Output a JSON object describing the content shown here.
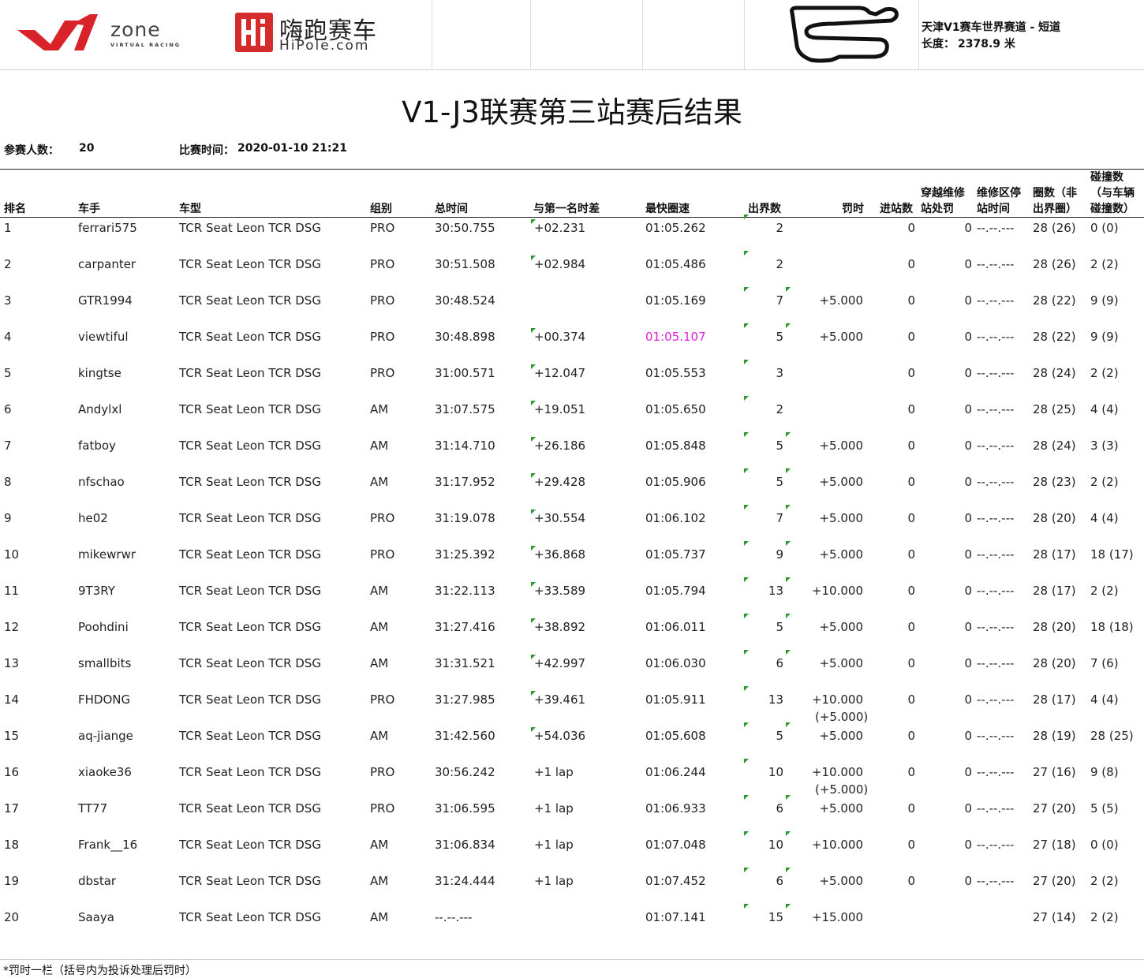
{
  "header": {
    "v1_logo": {
      "word": "zone",
      "tagline": "VIRTUAL RACING"
    },
    "hipole_logo": {
      "badge_text": "Hi",
      "name_cn": "嗨跑赛车",
      "domain": "HiPole.com"
    },
    "track": {
      "name": "天津V1赛车世界赛道 - 短道",
      "length_label": "长度：",
      "length_value": "2378.9 米"
    }
  },
  "title": "V1-J3联赛第三站赛后结果",
  "meta": {
    "entrants_label": "参赛人数：",
    "entrants_value": "20",
    "race_time_label": "比赛时间：",
    "race_time_value": "2020-01-10 21:21"
  },
  "columns": {
    "rank": "排名",
    "driver": "车手",
    "car": "车型",
    "group": "组别",
    "total_time": "总时间",
    "gap": "与第一名时差",
    "best_lap": "最快圈速",
    "cuts": "出界数",
    "penalty": "罚时",
    "pit_stops": "进站数",
    "drive_through_1": "穿越维修",
    "drive_through_2": "站处罚",
    "pit_time_1": "维修区停",
    "pit_time_2": "站时间",
    "laps_1": "圈数（非",
    "laps_2": "出界圈）",
    "collisions_1": "碰撞数",
    "collisions_2": "（与车辆",
    "collisions_3": "碰撞数）"
  },
  "rows": [
    {
      "rank": "1",
      "driver": "ferrari575",
      "car": "TCR Seat Leon TCR DSG",
      "group": "PRO",
      "total": "30:50.755",
      "gap": "+02.231",
      "best": "01:05.262",
      "cuts": "2",
      "penalty": "",
      "penalty_note": "",
      "pit": "0",
      "dt": "0",
      "pit_time": "--.--.---",
      "laps": "28 (26)",
      "coll": "0 (0)",
      "best_purple": false,
      "gap_flag": true,
      "cuts_flag_left": true,
      "cuts_flag_right": false
    },
    {
      "rank": "2",
      "driver": "carpanter",
      "car": "TCR Seat Leon TCR DSG",
      "group": "PRO",
      "total": "30:51.508",
      "gap": "+02.984",
      "best": "01:05.486",
      "cuts": "2",
      "penalty": "",
      "penalty_note": "",
      "pit": "0",
      "dt": "0",
      "pit_time": "--.--.---",
      "laps": "28 (26)",
      "coll": "2 (2)",
      "best_purple": false,
      "gap_flag": true,
      "cuts_flag_left": true,
      "cuts_flag_right": false
    },
    {
      "rank": "3",
      "driver": "GTR1994",
      "car": "TCR Seat Leon TCR DSG",
      "group": "PRO",
      "total": "30:48.524",
      "gap": "",
      "best": "01:05.169",
      "cuts": "7",
      "penalty": "+5.000",
      "penalty_note": "",
      "pit": "0",
      "dt": "0",
      "pit_time": "--.--.---",
      "laps": "28 (22)",
      "coll": "9 (9)",
      "best_purple": false,
      "gap_flag": false,
      "cuts_flag_left": true,
      "cuts_flag_right": true
    },
    {
      "rank": "4",
      "driver": "viewtiful",
      "car": "TCR Seat Leon TCR DSG",
      "group": "PRO",
      "total": "30:48.898",
      "gap": "+00.374",
      "best": "01:05.107",
      "cuts": "5",
      "penalty": "+5.000",
      "penalty_note": "",
      "pit": "0",
      "dt": "0",
      "pit_time": "--.--.---",
      "laps": "28 (22)",
      "coll": "9 (9)",
      "best_purple": true,
      "gap_flag": true,
      "cuts_flag_left": true,
      "cuts_flag_right": true
    },
    {
      "rank": "5",
      "driver": "kingtse",
      "car": "TCR Seat Leon TCR DSG",
      "group": "PRO",
      "total": "31:00.571",
      "gap": "+12.047",
      "best": "01:05.553",
      "cuts": "3",
      "penalty": "",
      "penalty_note": "",
      "pit": "0",
      "dt": "0",
      "pit_time": "--.--.---",
      "laps": "28 (24)",
      "coll": "2 (2)",
      "best_purple": false,
      "gap_flag": true,
      "cuts_flag_left": true,
      "cuts_flag_right": false
    },
    {
      "rank": "6",
      "driver": "Andylxl",
      "car": "TCR Seat Leon TCR DSG",
      "group": "AM",
      "total": "31:07.575",
      "gap": "+19.051",
      "best": "01:05.650",
      "cuts": "2",
      "penalty": "",
      "penalty_note": "",
      "pit": "0",
      "dt": "0",
      "pit_time": "--.--.---",
      "laps": "28 (25)",
      "coll": "4 (4)",
      "best_purple": false,
      "gap_flag": true,
      "cuts_flag_left": true,
      "cuts_flag_right": false
    },
    {
      "rank": "7",
      "driver": "fatboy",
      "car": "TCR Seat Leon TCR DSG",
      "group": "AM",
      "total": "31:14.710",
      "gap": "+26.186",
      "best": "01:05.848",
      "cuts": "5",
      "penalty": "+5.000",
      "penalty_note": "",
      "pit": "0",
      "dt": "0",
      "pit_time": "--.--.---",
      "laps": "28 (24)",
      "coll": "3 (3)",
      "best_purple": false,
      "gap_flag": true,
      "cuts_flag_left": true,
      "cuts_flag_right": true
    },
    {
      "rank": "8",
      "driver": "nfschao",
      "car": "TCR Seat Leon TCR DSG",
      "group": "AM",
      "total": "31:17.952",
      "gap": "+29.428",
      "best": "01:05.906",
      "cuts": "5",
      "penalty": "+5.000",
      "penalty_note": "",
      "pit": "0",
      "dt": "0",
      "pit_time": "--.--.---",
      "laps": "28 (23)",
      "coll": "2 (2)",
      "best_purple": false,
      "gap_flag": true,
      "cuts_flag_left": true,
      "cuts_flag_right": true
    },
    {
      "rank": "9",
      "driver": "he02",
      "car": "TCR Seat Leon TCR DSG",
      "group": "PRO",
      "total": "31:19.078",
      "gap": "+30.554",
      "best": "01:06.102",
      "cuts": "7",
      "penalty": "+5.000",
      "penalty_note": "",
      "pit": "0",
      "dt": "0",
      "pit_time": "--.--.---",
      "laps": "28 (20)",
      "coll": "4 (4)",
      "best_purple": false,
      "gap_flag": true,
      "cuts_flag_left": true,
      "cuts_flag_right": true
    },
    {
      "rank": "10",
      "driver": "mikewrwr",
      "car": "TCR Seat Leon TCR DSG",
      "group": "PRO",
      "total": "31:25.392",
      "gap": "+36.868",
      "best": "01:05.737",
      "cuts": "9",
      "penalty": "+5.000",
      "penalty_note": "",
      "pit": "0",
      "dt": "0",
      "pit_time": "--.--.---",
      "laps": "28 (17)",
      "coll": "18 (17)",
      "best_purple": false,
      "gap_flag": true,
      "cuts_flag_left": true,
      "cuts_flag_right": true
    },
    {
      "rank": "11",
      "driver": "9T3RY",
      "car": "TCR Seat Leon TCR DSG",
      "group": "AM",
      "total": "31:22.113",
      "gap": "+33.589",
      "best": "01:05.794",
      "cuts": "13",
      "penalty": "+10.000",
      "penalty_note": "",
      "pit": "0",
      "dt": "0",
      "pit_time": "--.--.---",
      "laps": "28 (17)",
      "coll": "2 (2)",
      "best_purple": false,
      "gap_flag": true,
      "cuts_flag_left": true,
      "cuts_flag_right": true
    },
    {
      "rank": "12",
      "driver": "Poohdini",
      "car": "TCR Seat Leon TCR DSG",
      "group": "AM",
      "total": "31:27.416",
      "gap": "+38.892",
      "best": "01:06.011",
      "cuts": "5",
      "penalty": "+5.000",
      "penalty_note": "",
      "pit": "0",
      "dt": "0",
      "pit_time": "--.--.---",
      "laps": "28 (20)",
      "coll": "18 (18)",
      "best_purple": false,
      "gap_flag": true,
      "cuts_flag_left": true,
      "cuts_flag_right": true
    },
    {
      "rank": "13",
      "driver": "smallbits",
      "car": "TCR Seat Leon TCR DSG",
      "group": "AM",
      "total": "31:31.521",
      "gap": "+42.997",
      "best": "01:06.030",
      "cuts": "6",
      "penalty": "+5.000",
      "penalty_note": "",
      "pit": "0",
      "dt": "0",
      "pit_time": "--.--.---",
      "laps": "28 (20)",
      "coll": "7 (6)",
      "best_purple": false,
      "gap_flag": true,
      "cuts_flag_left": true,
      "cuts_flag_right": true
    },
    {
      "rank": "14",
      "driver": "FHDONG",
      "car": "TCR Seat Leon TCR DSG",
      "group": "PRO",
      "total": "31:27.985",
      "gap": "+39.461",
      "best": "01:05.911",
      "cuts": "13",
      "penalty": "+10.000",
      "penalty_note": "(+5.000)",
      "pit": "0",
      "dt": "0",
      "pit_time": "--.--.---",
      "laps": "28 (17)",
      "coll": "4 (4)",
      "best_purple": false,
      "gap_flag": true,
      "cuts_flag_left": true,
      "cuts_flag_right": false
    },
    {
      "rank": "15",
      "driver": "aq-jiange",
      "car": "TCR Seat Leon TCR DSG",
      "group": "AM",
      "total": "31:42.560",
      "gap": "+54.036",
      "best": "01:05.608",
      "cuts": "5",
      "penalty": "+5.000",
      "penalty_note": "",
      "pit": "0",
      "dt": "0",
      "pit_time": "--.--.---",
      "laps": "28 (19)",
      "coll": "28 (25)",
      "best_purple": false,
      "gap_flag": true,
      "cuts_flag_left": true,
      "cuts_flag_right": true
    },
    {
      "rank": "16",
      "driver": "xiaoke36",
      "car": "TCR Seat Leon TCR DSG",
      "group": "PRO",
      "total": "30:56.242",
      "gap": "+1 lap",
      "best": "01:06.244",
      "cuts": "10",
      "penalty": "+10.000",
      "penalty_note": "(+5.000)",
      "pit": "0",
      "dt": "0",
      "pit_time": "--.--.---",
      "laps": "27 (16)",
      "coll": "9 (8)",
      "best_purple": false,
      "gap_flag": false,
      "cuts_flag_left": true,
      "cuts_flag_right": false
    },
    {
      "rank": "17",
      "driver": "TT77",
      "car": "TCR Seat Leon TCR DSG",
      "group": "PRO",
      "total": "31:06.595",
      "gap": "+1 lap",
      "best": "01:06.933",
      "cuts": "6",
      "penalty": "+5.000",
      "penalty_note": "",
      "pit": "0",
      "dt": "0",
      "pit_time": "--.--.---",
      "laps": "27 (20)",
      "coll": "5 (5)",
      "best_purple": false,
      "gap_flag": false,
      "cuts_flag_left": true,
      "cuts_flag_right": true
    },
    {
      "rank": "18",
      "driver": "Frank__16",
      "car": "TCR Seat Leon TCR DSG",
      "group": "AM",
      "total": "31:06.834",
      "gap": "+1 lap",
      "best": "01:07.048",
      "cuts": "10",
      "penalty": "+10.000",
      "penalty_note": "",
      "pit": "0",
      "dt": "0",
      "pit_time": "--.--.---",
      "laps": "27 (18)",
      "coll": "0 (0)",
      "best_purple": false,
      "gap_flag": false,
      "cuts_flag_left": true,
      "cuts_flag_right": true
    },
    {
      "rank": "19",
      "driver": "dbstar",
      "car": "TCR Seat Leon TCR DSG",
      "group": "AM",
      "total": "31:24.444",
      "gap": "+1 lap",
      "best": "01:07.452",
      "cuts": "6",
      "penalty": "+5.000",
      "penalty_note": "",
      "pit": "0",
      "dt": "0",
      "pit_time": "--.--.---",
      "laps": "27 (20)",
      "coll": "2 (2)",
      "best_purple": false,
      "gap_flag": false,
      "cuts_flag_left": true,
      "cuts_flag_right": true
    },
    {
      "rank": "20",
      "driver": "Saaya",
      "car": "TCR Seat Leon TCR DSG",
      "group": "AM",
      "total": "--.--.---",
      "gap": "",
      "best": "01:07.141",
      "cuts": "15",
      "penalty": "+15.000",
      "penalty_note": "",
      "pit": "",
      "dt": "",
      "pit_time": "",
      "laps": "27 (14)",
      "coll": "2 (2)",
      "best_purple": false,
      "gap_flag": false,
      "cuts_flag_left": true,
      "cuts_flag_right": true
    }
  ],
  "footer_note": "*罚时一栏（括号内为投诉处理后罚时）",
  "colors": {
    "fastest_lap": "#e020d8",
    "flag_marker": "#2a9a2a",
    "v1_red": "#d8232a",
    "hipole_red": "#d52b2b"
  }
}
